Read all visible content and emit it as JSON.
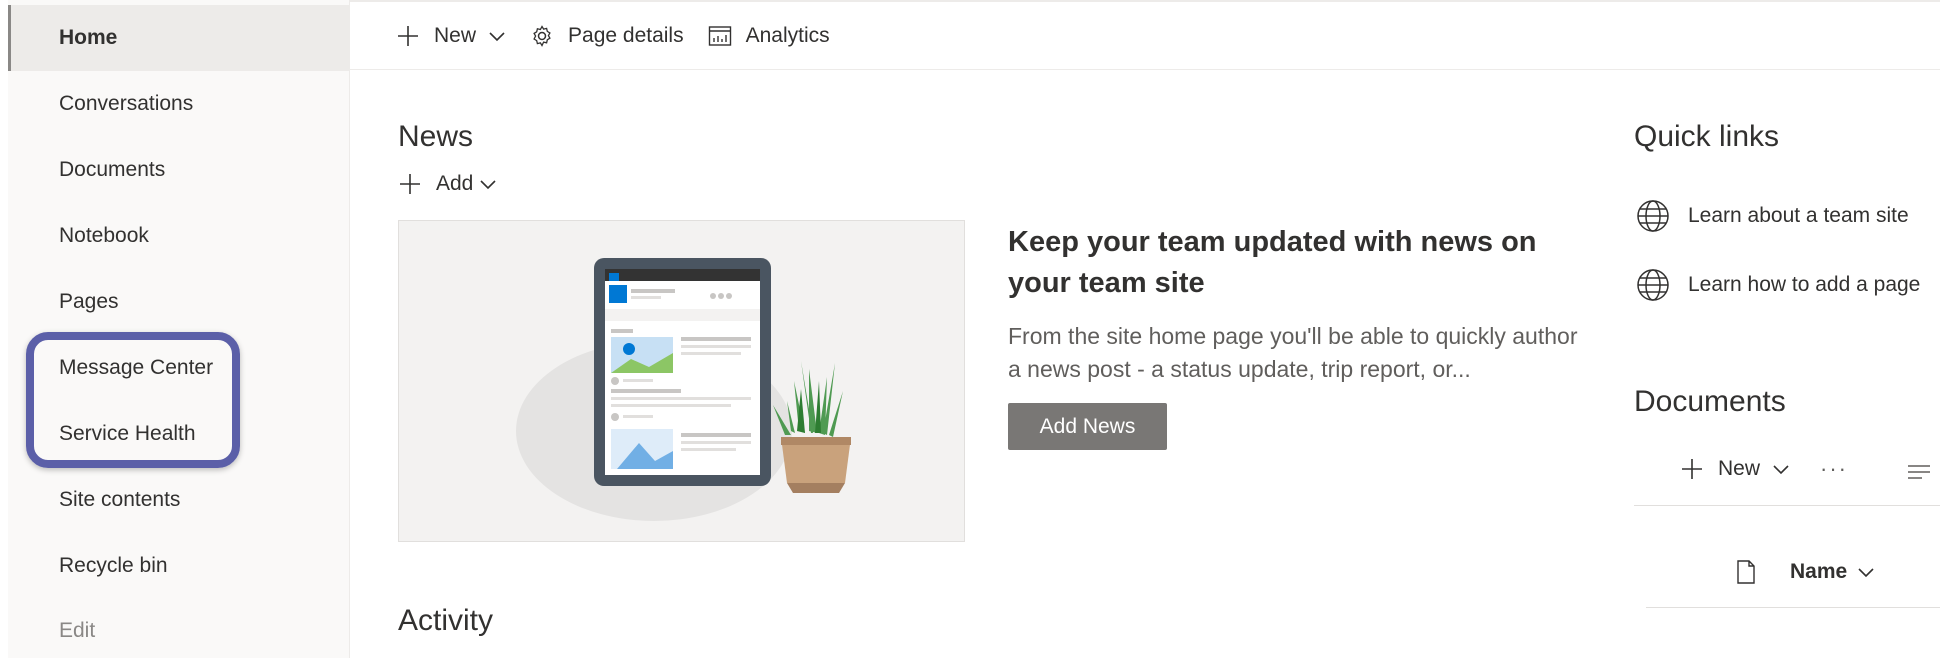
{
  "sidebar": {
    "items": [
      {
        "label": "Home"
      },
      {
        "label": "Conversations"
      },
      {
        "label": "Documents"
      },
      {
        "label": "Notebook"
      },
      {
        "label": "Pages"
      },
      {
        "label": "Message Center"
      },
      {
        "label": "Service Health"
      },
      {
        "label": "Site contents"
      },
      {
        "label": "Recycle bin"
      },
      {
        "label": "Edit"
      }
    ]
  },
  "commandbar": {
    "new_label": "New",
    "page_details_label": "Page details",
    "analytics_label": "Analytics"
  },
  "news": {
    "title": "News",
    "add_label": "Add",
    "headline": "Keep your team updated with news on your team site",
    "description": "From the site home page you'll be able to quickly author a news post - a status update, trip report, or...",
    "add_news_label": "Add News"
  },
  "activity": {
    "title": "Activity"
  },
  "quick_links": {
    "title": "Quick links",
    "items": [
      {
        "label": "Learn about a team site",
        "icon": "globe-icon"
      },
      {
        "label": "Learn how to add a page",
        "icon": "globe-icon"
      }
    ]
  },
  "documents": {
    "title": "Documents",
    "new_label": "New",
    "more_label": "···",
    "column_name": "Name"
  },
  "colors": {
    "highlight": "#5b5fa8",
    "button": "#797775",
    "sidebar_bg": "#faf9f8"
  }
}
